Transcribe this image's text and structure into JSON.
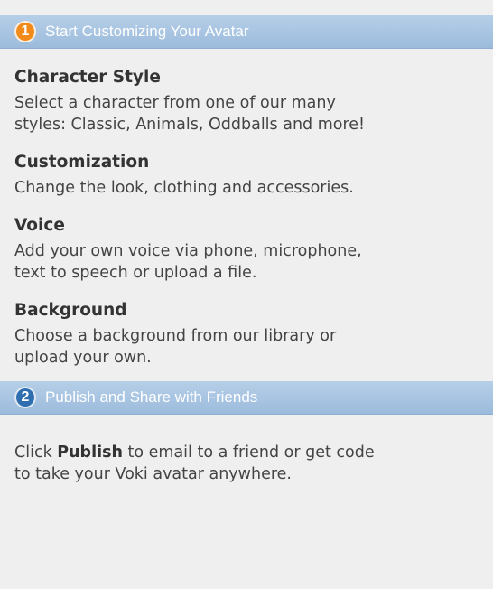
{
  "step1": {
    "number": "1",
    "title": "Start Customizing Your Avatar",
    "badge_color": "#f28a1a"
  },
  "sections": [
    {
      "title": "Character Style",
      "lines": [
        "Select a character from one of our many",
        "styles: Classic, Animals, Oddballs and more!"
      ]
    },
    {
      "title": "Customization",
      "lines": [
        "Change the look, clothing and accessories."
      ]
    },
    {
      "title": "Voice",
      "lines": [
        "Add your own voice via phone, microphone,",
        "text to speech or upload a file."
      ]
    },
    {
      "title": "Background",
      "lines": [
        "Choose a background from our library or",
        "upload your own."
      ]
    }
  ],
  "step2": {
    "number": "2",
    "title": "Publish and Share with Friends",
    "badge_color": "#2f6fb0"
  },
  "publish": {
    "line1_pre": "Click ",
    "line1_bold": "Publish",
    "line1_post": " to email to a friend or get code",
    "line2": "to take your Voki avatar anywhere."
  },
  "colors": {
    "header_bar": "#a8c5e3",
    "background": "#efefef"
  }
}
